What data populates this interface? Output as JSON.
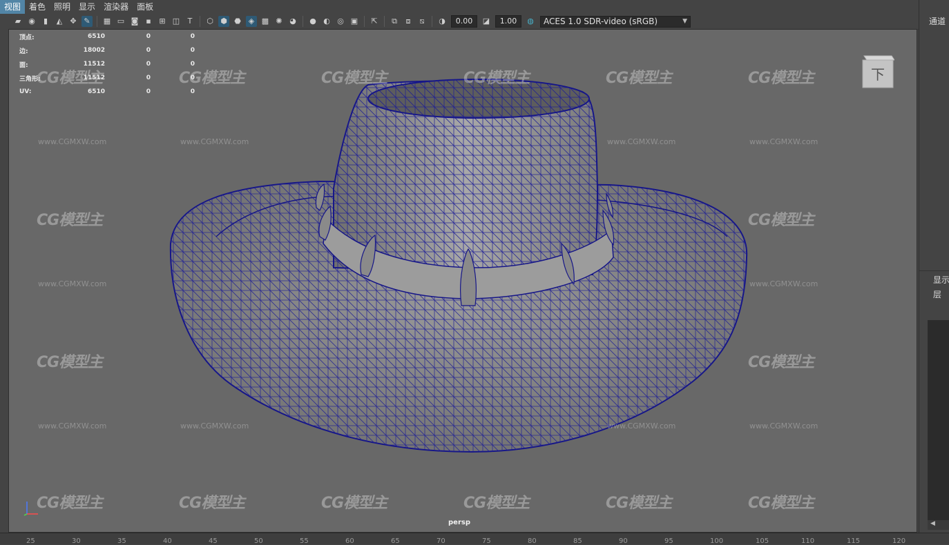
{
  "menu": {
    "items": [
      {
        "label": "视图",
        "active": true
      },
      {
        "label": "着色",
        "active": false
      },
      {
        "label": "照明",
        "active": false
      },
      {
        "label": "显示",
        "active": false
      },
      {
        "label": "渲染器",
        "active": false
      },
      {
        "label": "面板",
        "active": false
      }
    ]
  },
  "toolbar": {
    "exposure_value": "0.00",
    "gamma_value": "1.00",
    "color_space": "ACES 1.0 SDR-video (sRGB)",
    "icons": [
      "camera-select-icon",
      "camera-attributes-icon",
      "bookmark-icon",
      "image-plane-icon",
      "2d-pan-zoom-icon",
      "grease-pencil-icon",
      "grid-icon",
      "film-gate-icon",
      "resolution-gate-icon",
      "gate-mask-icon",
      "field-chart-icon",
      "safe-action-icon",
      "safe-title-icon",
      "wireframe-icon",
      "smooth-shade-icon",
      "wireframe-on-shaded-icon",
      "textured-icon",
      "use-all-lights-icon",
      "shadows-icon",
      "screen-space-ao-icon",
      "motion-blur-icon",
      "anti-aliasing-icon",
      "isolate-select-icon",
      "xray-icon",
      "xray-joints-icon",
      "backface-culling-icon",
      "exposure-icon",
      "gamma-icon",
      "color-management-icon"
    ]
  },
  "hud": {
    "rows": [
      {
        "label": "顶点:",
        "value": "6510",
        "selected": "0",
        "component": "0"
      },
      {
        "label": "边:",
        "value": "18002",
        "selected": "0",
        "component": "0"
      },
      {
        "label": "面:",
        "value": "11512",
        "selected": "0",
        "component": "0"
      },
      {
        "label": "三角形:",
        "value": "11512",
        "selected": "0",
        "component": "0"
      },
      {
        "label": "UV:",
        "value": "6510",
        "selected": "0",
        "component": "0"
      }
    ]
  },
  "viewport": {
    "camera_label": "persp",
    "viewcube_face": "下",
    "background_color": "#686868",
    "wireframe_color": "#1a1a8c",
    "watermark_logo": "CG模型主",
    "watermark_url": "www.CGMXW.com"
  },
  "ruler": {
    "ticks": [
      "25",
      "30",
      "35",
      "40",
      "45",
      "50",
      "55",
      "60",
      "65",
      "70",
      "75",
      "80",
      "85",
      "90",
      "95",
      "100",
      "105",
      "110",
      "115",
      "120"
    ]
  },
  "right_panel": {
    "tab_label": "通道",
    "display_label": "显示",
    "layer_label": "层"
  }
}
